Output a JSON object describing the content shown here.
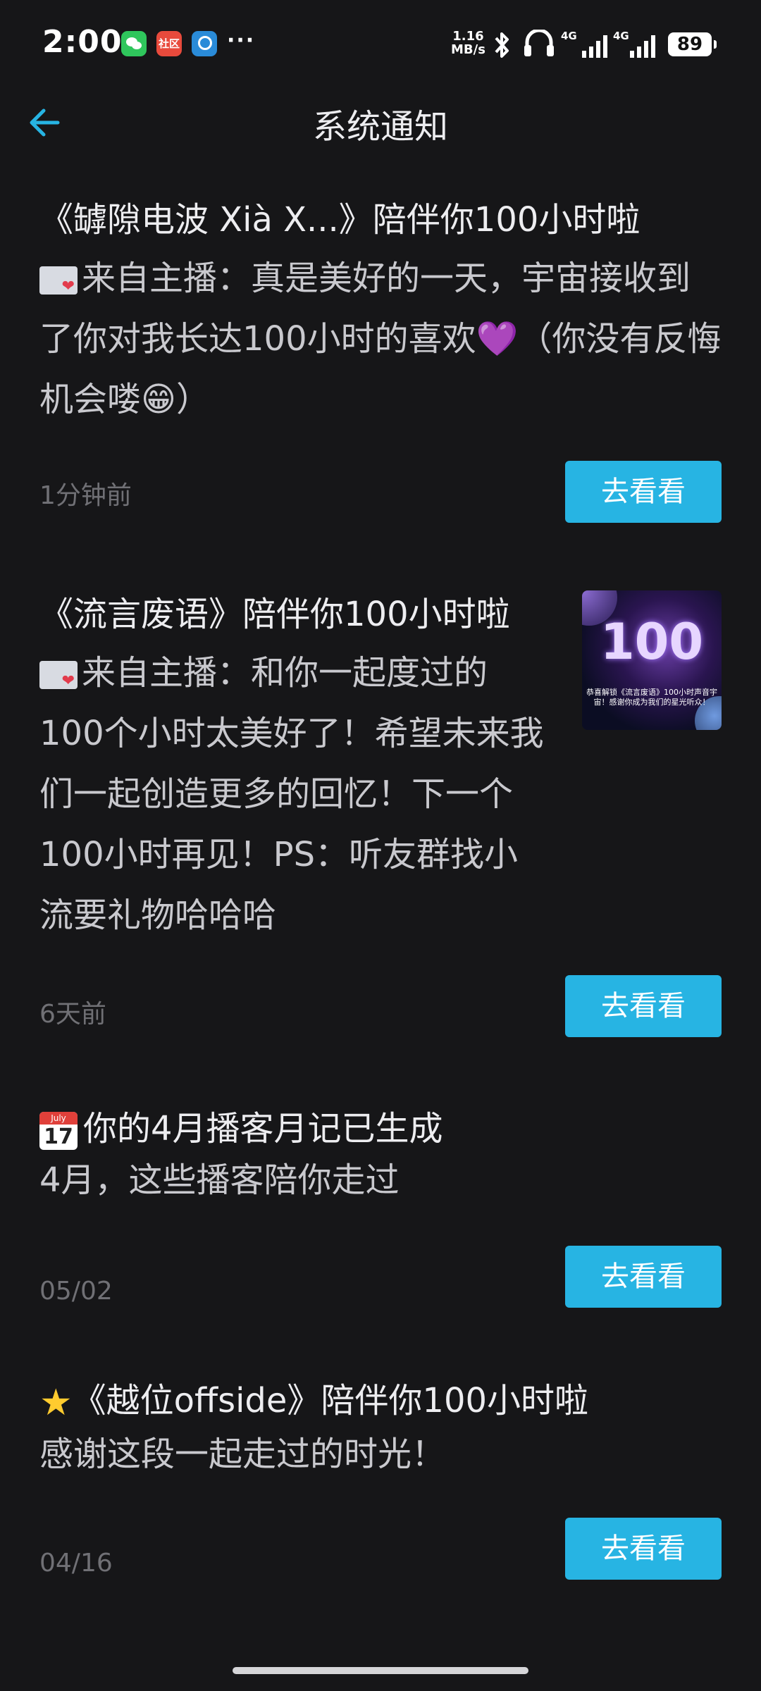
{
  "status_bar": {
    "time": "2:00",
    "apps": [
      "wechat-icon",
      "community-icon",
      "station-icon"
    ],
    "community_label": "社区",
    "more": "···",
    "net_speed_value": "1.16",
    "net_speed_unit": "MB/s",
    "signal1": "4G",
    "signal2": "4G",
    "battery": "89"
  },
  "header": {
    "title": "系统通知"
  },
  "notifications": [
    {
      "title": "《罅隙电波 Xià X...》陪伴你100小时啦",
      "body_lead": "来自主播：真是美好的一天，宇宙接收到了你对我长达100小时的喜欢💜（你没有反悔机会喽😁）",
      "time": "1分钟前",
      "button": "去看看"
    },
    {
      "title": "《流言废语》陪伴你100小时啦",
      "body_lead": "来自主播：和你一起度过的100个小时太美好了！希望未来我们一起创造更多的回忆！下一个100小时再见！PS：听友群找小流要礼物哈哈哈",
      "time": "6天前",
      "button": "去看看",
      "thumb_big": "100",
      "thumb_caption": "恭喜解锁《流言废语》100小时声音宇宙！感谢你成为我们的星光听众！"
    },
    {
      "title": "你的4月播客月记已生成",
      "body_lead": "4月，这些播客陪你走过",
      "time": "05/02",
      "button": "去看看",
      "cal_month": "July",
      "cal_day": "17"
    },
    {
      "title": "《越位offside》陪伴你100小时啦",
      "body_lead": "感谢这段一起走过的时光！",
      "time": "04/16",
      "button": "去看看"
    }
  ],
  "colors": {
    "background": "#161618",
    "accent": "#27b4e3",
    "secondary_text": "#707075"
  }
}
